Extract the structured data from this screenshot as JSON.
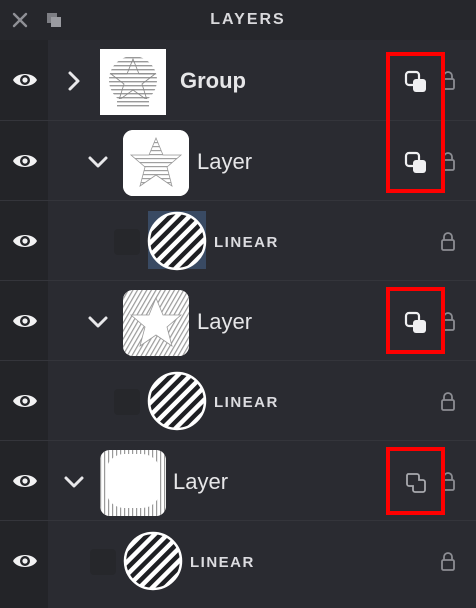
{
  "panel": {
    "title": "LAYERS",
    "close_icon": "close-icon",
    "menu_icon": "layers-menu-icon"
  },
  "rows": [
    {
      "type": "group",
      "label": "Group",
      "expanded": false,
      "visible": true,
      "blend_icon": "blend-mode-icon",
      "locked": false
    },
    {
      "type": "layer",
      "label": "Layer",
      "expanded": true,
      "visible": true,
      "shape": "star",
      "blend_icon": "blend-mode-icon",
      "locked": false
    },
    {
      "type": "fill",
      "label": "LINEAR",
      "visible": true,
      "selected": true,
      "locked": false
    },
    {
      "type": "layer",
      "label": "Layer",
      "expanded": true,
      "visible": true,
      "shape": "star",
      "blend_icon": "blend-mode-icon",
      "locked": false
    },
    {
      "type": "fill",
      "label": "LINEAR",
      "visible": true,
      "locked": false
    },
    {
      "type": "layer",
      "label": "Layer",
      "expanded": true,
      "visible": true,
      "shape": "rounded-square",
      "blend_icon": "blend-mode-outline-icon",
      "locked": false
    },
    {
      "type": "fill",
      "label": "LINEAR",
      "visible": true,
      "locked": false
    }
  ],
  "colors": {
    "panel_bg": "#2a2b31",
    "eye_column_bg": "#232428",
    "highlight": "#ff0000",
    "selection": "#394a63"
  }
}
